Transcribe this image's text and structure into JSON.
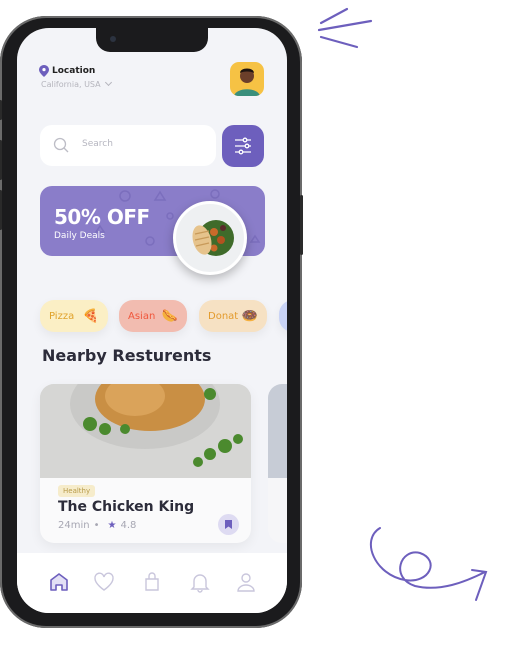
{
  "header": {
    "location_label": "Location",
    "location_value": "California, USA",
    "location_icon": "map-pin-icon",
    "avatar": "user-avatar"
  },
  "search": {
    "placeholder": "Search",
    "filter_icon": "sliders-icon"
  },
  "banner": {
    "title": "50% OFF",
    "subtitle": "Daily Deals"
  },
  "categories": [
    {
      "label": "Pizza",
      "bg": "#fbefc5",
      "color": "#e0a22a"
    },
    {
      "label": "Asian",
      "bg": "#f2bcb0",
      "color": "#f0573c"
    },
    {
      "label": "Donat",
      "bg": "#f6e1c3",
      "color": "#e39b2d"
    }
  ],
  "section_title": "Nearby Resturents",
  "restaurants": [
    {
      "tag": "Healthy",
      "name": "The Chicken King",
      "time": "24min",
      "dot": "•",
      "rating": "4.8"
    }
  ],
  "nav": [
    "home",
    "favorites",
    "orders",
    "notifications",
    "profile"
  ],
  "colors": {
    "accent": "#6d5fbd",
    "banner": "#8a7dc9"
  }
}
